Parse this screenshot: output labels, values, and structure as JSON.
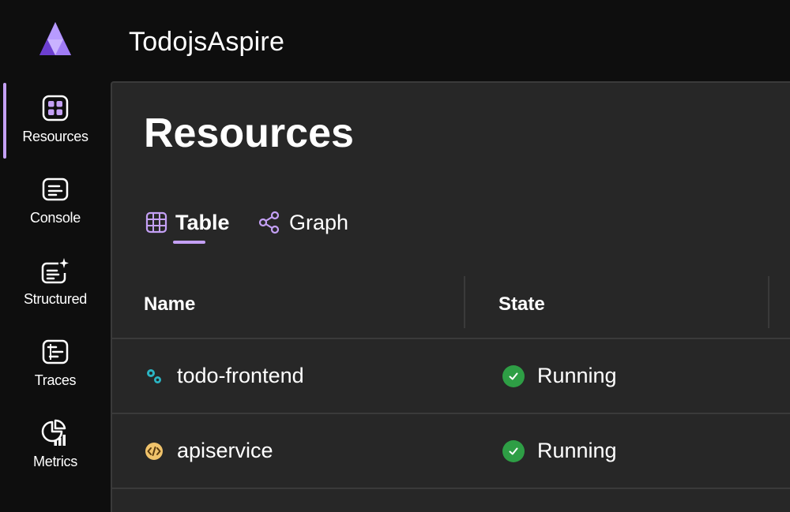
{
  "app": {
    "title": "TodojsAspire",
    "accent_color": "#c4a0f5"
  },
  "sidebar": {
    "items": [
      {
        "label": "Resources",
        "icon": "resources-icon",
        "active": true
      },
      {
        "label": "Console",
        "icon": "console-icon",
        "active": false
      },
      {
        "label": "Structured",
        "icon": "structured-icon",
        "active": false
      },
      {
        "label": "Traces",
        "icon": "traces-icon",
        "active": false
      },
      {
        "label": "Metrics",
        "icon": "metrics-icon",
        "active": false
      }
    ]
  },
  "main": {
    "title": "Resources",
    "tabs": [
      {
        "label": "Table",
        "icon": "table-icon",
        "selected": true
      },
      {
        "label": "Graph",
        "icon": "graph-icon",
        "selected": false
      }
    ],
    "table": {
      "columns": [
        "Name",
        "State"
      ],
      "rows": [
        {
          "name": "todo-frontend",
          "icon": "project-gears-icon",
          "state": "Running",
          "state_color": "#2e9e45"
        },
        {
          "name": "apiservice",
          "icon": "code-project-icon",
          "state": "Running",
          "state_color": "#2e9e45"
        }
      ]
    }
  }
}
